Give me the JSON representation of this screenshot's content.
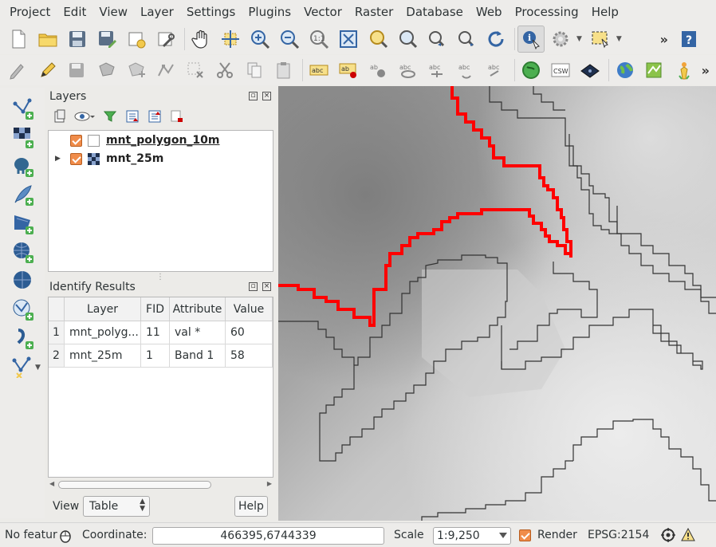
{
  "menubar": {
    "items": [
      "Project",
      "Edit",
      "View",
      "Layer",
      "Settings",
      "Plugins",
      "Vector",
      "Raster",
      "Database",
      "Web",
      "Processing",
      "Help"
    ]
  },
  "toolbar": {
    "overflow_label": "»"
  },
  "layers_panel": {
    "title": "Layers",
    "layers": [
      {
        "name": "mnt_polygon_10m",
        "checked": true
      },
      {
        "name": "mnt_25m",
        "checked": true
      }
    ]
  },
  "identify_panel": {
    "title": "Identify Results",
    "columns": [
      "",
      "Layer",
      "FID",
      "Attribute",
      "Value"
    ],
    "rows": [
      [
        "1",
        "mnt_polyg...",
        "11",
        "val *",
        "60"
      ],
      [
        "2",
        "mnt_25m",
        "1",
        "Band 1",
        "58"
      ]
    ],
    "view_label": "View",
    "view_value": "Table",
    "help_label": "Help"
  },
  "statusbar": {
    "message": "No featur",
    "coordinate_label": "Coordinate:",
    "coordinate_value": "466395,6744339",
    "scale_label": "Scale",
    "scale_value": "1:9,250",
    "render_label": "Render",
    "crs_label": "EPSG:2154"
  },
  "colors": {
    "accent_orange": "#f08c4a",
    "contour_red": "#ff0000"
  }
}
